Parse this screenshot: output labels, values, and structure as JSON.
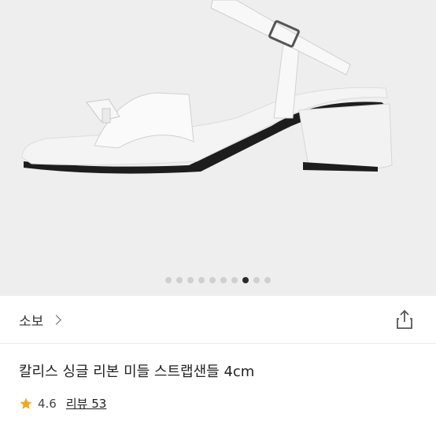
{
  "gallery": {
    "total": 10,
    "active_index": 7
  },
  "brand": {
    "name": "소보"
  },
  "product": {
    "title": "칼리스 싱글 리본 미들 스트랩샌들 4cm"
  },
  "rating": {
    "value": "4.6",
    "reviews_label": "리뷰 53"
  },
  "icons": {
    "brand_chevron": "chevron-right-icon",
    "share": "share-icon",
    "rating": "star-icon"
  },
  "colors": {
    "star": "#f5a623",
    "dot_active": "#2a2a2a",
    "dot_inactive": "#cfcfd2"
  }
}
